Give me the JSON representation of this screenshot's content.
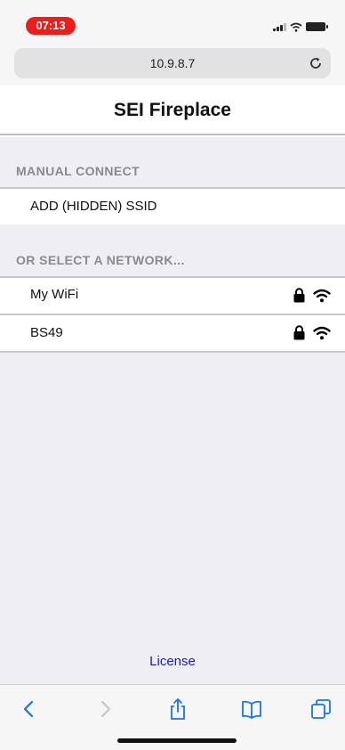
{
  "status_bar": {
    "time": "07:13"
  },
  "browser": {
    "url": "10.9.8.7"
  },
  "page": {
    "title": "SEI Fireplace"
  },
  "manual_connect": {
    "header": "MANUAL CONNECT",
    "add_hidden_label": "ADD (HIDDEN) SSID"
  },
  "networks": {
    "header": "OR SELECT A NETWORK...",
    "items": [
      {
        "ssid": "My WiFi",
        "secured": true,
        "icons": [
          "lock-icon",
          "wifi-icon"
        ]
      },
      {
        "ssid": "BS49",
        "secured": true,
        "icons": [
          "lock-icon",
          "wifi-icon"
        ]
      }
    ]
  },
  "footer": {
    "license_link": "License"
  },
  "toolbar": {
    "icons": [
      "back-icon",
      "forward-icon",
      "share-icon",
      "bookmarks-icon",
      "tabs-icon"
    ]
  },
  "colors": {
    "time_pill": "#ef1c1c",
    "link": "#1d1bb0",
    "accent": "#1a73e8",
    "background": "#efeff3"
  }
}
